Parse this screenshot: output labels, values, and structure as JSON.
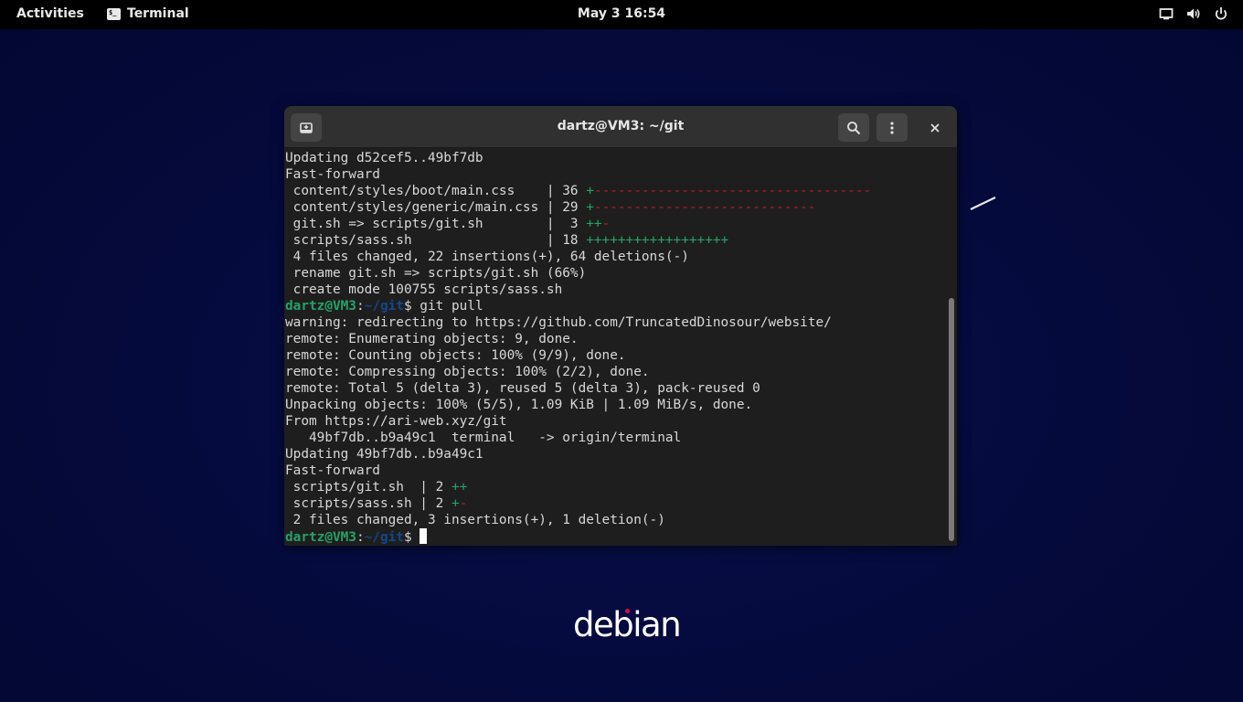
{
  "topbar": {
    "activities_label": "Activities",
    "app_name": "Terminal",
    "app_icon_glyph": "$_",
    "clock": "May 3  16:54",
    "tray_icons": [
      "screen-icon",
      "volume-icon",
      "power-icon"
    ]
  },
  "window": {
    "title": "dartz@VM3: ~/git",
    "header_icons": [
      "new-tab-icon",
      "search-icon",
      "kebab-menu-icon",
      "close-icon"
    ]
  },
  "terminal": {
    "lines": [
      {
        "text": "Updating d52cef5..49bf7db"
      },
      {
        "text": "Fast-forward"
      },
      {
        "text": " content/styles/boot/main.css    | 36 ",
        "plus": "+",
        "minus": "-----------------------------------"
      },
      {
        "text": " content/styles/generic/main.css | 29 ",
        "plus": "+",
        "minus": "----------------------------"
      },
      {
        "text": " git.sh => scripts/git.sh        |  3 ",
        "plus": "++",
        "minus": "-"
      },
      {
        "text": " scripts/sass.sh                 | 18 ",
        "plus": "++++++++++++++++++",
        "minus": ""
      },
      {
        "text": " 4 files changed, 22 insertions(+), 64 deletions(-)"
      },
      {
        "text": " rename git.sh => scripts/git.sh (66%)"
      },
      {
        "text": " create mode 100755 scripts/sass.sh"
      },
      {
        "prompt_user": "dartz@VM3",
        "prompt_sep": ":",
        "prompt_path": "~/git",
        "text": "$ git pull"
      },
      {
        "text": "warning: redirecting to https://github.com/TruncatedDinosour/website/"
      },
      {
        "text": "remote: Enumerating objects: 9, done."
      },
      {
        "text": "remote: Counting objects: 100% (9/9), done."
      },
      {
        "text": "remote: Compressing objects: 100% (2/2), done."
      },
      {
        "text": "remote: Total 5 (delta 3), reused 5 (delta 3), pack-reused 0"
      },
      {
        "text": "Unpacking objects: 100% (5/5), 1.09 KiB | 1.09 MiB/s, done."
      },
      {
        "text": "From https://ari-web.xyz/git"
      },
      {
        "text": "   49bf7db..b9a49c1  terminal   -> origin/terminal"
      },
      {
        "text": "Updating 49bf7db..b9a49c1"
      },
      {
        "text": "Fast-forward"
      },
      {
        "text": " scripts/git.sh  | 2 ",
        "plus": "++",
        "minus": ""
      },
      {
        "text": " scripts/sass.sh | 2 ",
        "plus": "+",
        "minus": "-"
      },
      {
        "text": " 2 files changed, 3 insertions(+), 1 deletion(-)"
      },
      {
        "prompt_user": "dartz@VM3",
        "prompt_sep": ":",
        "prompt_path": "~/git",
        "text": "$ ",
        "cursor": true
      }
    ],
    "scroll_fraction_visible": 0.61,
    "colors": {
      "prompt_user": "#26a269",
      "prompt_path": "#12488b",
      "diff_plus": "#26a269",
      "diff_minus": "#c01c28"
    }
  },
  "desktop": {
    "logo_text": "debian",
    "logo_accent": "#d70751"
  }
}
